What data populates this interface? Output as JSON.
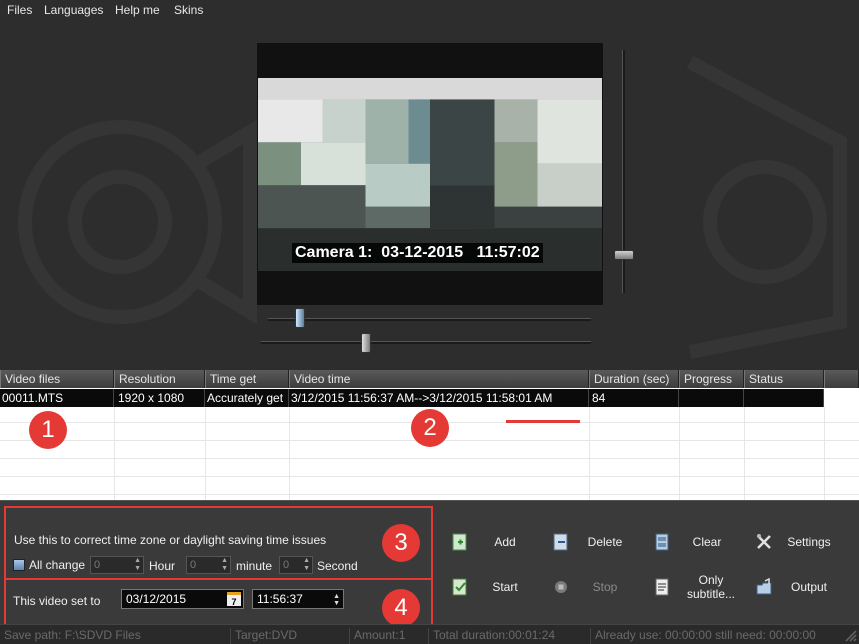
{
  "menu": {
    "files": "Files",
    "languages": "Languages",
    "help": "Help me",
    "skins": "Skins"
  },
  "preview": {
    "overlay_text": "Camera 1:  03-12-2015   11:57:02"
  },
  "table": {
    "headers": [
      "Video files",
      "Resolution",
      "Time get",
      "Video time",
      "Duration (sec)",
      "Progress",
      "Status"
    ],
    "rows": [
      {
        "file": "00011.MTS",
        "resolution": "1920 x 1080",
        "time_get": "Accurately get",
        "video_time": "3/12/2015 11:56:37 AM-->3/12/2015 11:58:01 AM",
        "duration": "84",
        "progress": "",
        "status": ""
      }
    ]
  },
  "markers": {
    "m1": "1",
    "m2": "2",
    "m3": "3",
    "m4": "4"
  },
  "timezone": {
    "hint": "Use this to correct time zone or daylight saving time issues",
    "all_change_label": "All change",
    "hour_value": "0",
    "hour_label": "Hour",
    "minute_value": "0",
    "minute_label": "minute",
    "second_value": "0",
    "second_label": "Second"
  },
  "set_video": {
    "label": "This video set to",
    "date": "03/12/2015",
    "date_icon": "7",
    "time": "11:56:37"
  },
  "buttons": {
    "add": "Add",
    "delete": "Delete",
    "clear": "Clear",
    "settings": "Settings",
    "start": "Start",
    "stop": "Stop",
    "only_subtitle": "Only\nsubtitle...",
    "output": "Output"
  },
  "status": {
    "save_path": "Save path:  F:\\SDVD Files",
    "target": "Target:DVD",
    "amount": "Amount:1",
    "total_duration": "Total duration:00:01:24",
    "already_use": "Already use: 00:00:00 still need: 00:00:00"
  },
  "colors": {
    "accent_red": "#e53935",
    "panel_bg": "#3a3a3a",
    "app_bg": "#2d2d2d"
  }
}
